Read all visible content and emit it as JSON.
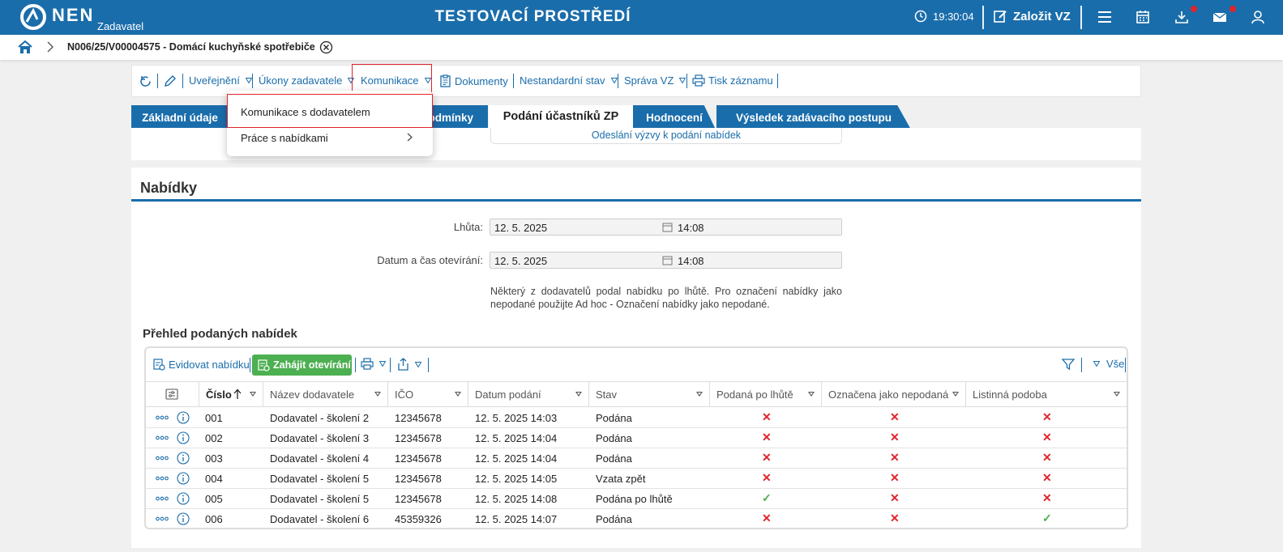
{
  "header": {
    "logo_text": "NEN",
    "logo_sub": "Zadavatel",
    "env_title": "TESTOVACÍ PROSTŘEDÍ",
    "clock": "19:30:04",
    "create_label": "Založit VZ"
  },
  "breadcrumb": {
    "title": "N006/25/V00004575 - Domácí kuchyňské spotřebiče"
  },
  "toolbar": {
    "items": [
      "Uveřejnění",
      "Úkony zadavatele",
      "Komunikace",
      "Dokumenty",
      "Nestandardní stav",
      "Správa VZ",
      "Tisk záznamu"
    ]
  },
  "dropdown": {
    "items": [
      "Komunikace s dodavatelem",
      "Práce s nabídkami"
    ]
  },
  "tabs": [
    "Základní údaje",
    "podmínky",
    "Podání účastníků ZP",
    "Hodnocení",
    "Výsledek zadávacího postupu"
  ],
  "subtab": "Odeslání výzvy k podání nabídek",
  "nabidky": {
    "title": "Nabídky",
    "lhuta_label": "Lhůta:",
    "lhuta_date": "12. 5. 2025",
    "lhuta_time": "14:08",
    "open_label": "Datum a čas otevírání:",
    "open_date": "12. 5. 2025",
    "open_time": "14:08",
    "note": "Některý z dodavatelů podal nabídku po lhůtě. Pro označení nabídky jako nepodané použijte Ad hoc - Označení nabídky jako nepodané.",
    "section_title": "Přehled podaných nabídek"
  },
  "grid": {
    "evidovat": "Evidovat nabídku",
    "zahajit": "Zahájit otevírání",
    "vse": "Vše",
    "columns": [
      "Číslo",
      "Název dodavatele",
      "IČO",
      "Datum podání",
      "Stav",
      "Podaná po lhůtě",
      "Označena jako nepodaná",
      "Listinná podoba"
    ],
    "rows": [
      {
        "cislo": "001",
        "nazev": "Dodavatel - školení 2",
        "ico": "12345678",
        "datum": "12. 5. 2025 14:03",
        "stav": "Podána",
        "po_lhute": false,
        "nepodana": false,
        "listinna": false
      },
      {
        "cislo": "002",
        "nazev": "Dodavatel - školení 3",
        "ico": "12345678",
        "datum": "12. 5. 2025 14:04",
        "stav": "Podána",
        "po_lhute": false,
        "nepodana": false,
        "listinna": false
      },
      {
        "cislo": "003",
        "nazev": "Dodavatel - školení 4",
        "ico": "12345678",
        "datum": "12. 5. 2025 14:04",
        "stav": "Podána",
        "po_lhute": false,
        "nepodana": false,
        "listinna": false
      },
      {
        "cislo": "004",
        "nazev": "Dodavatel - školení 5",
        "ico": "12345678",
        "datum": "12. 5. 2025 14:05",
        "stav": "Vzata zpět",
        "po_lhute": false,
        "nepodana": false,
        "listinna": false
      },
      {
        "cislo": "005",
        "nazev": "Dodavatel - školení 5",
        "ico": "12345678",
        "datum": "12. 5. 2025 14:08",
        "stav": "Podána po lhůtě",
        "po_lhute": true,
        "nepodana": false,
        "listinna": false
      },
      {
        "cislo": "006",
        "nazev": "Dodavatel - školení 6",
        "ico": "45359326",
        "datum": "12. 5. 2025 14:07",
        "stav": "Podána",
        "po_lhute": false,
        "nepodana": false,
        "listinna": true
      }
    ]
  },
  "colors": {
    "brand": "#1a6dab",
    "accent_green": "#4caf50",
    "alert_red": "#e0242b"
  }
}
